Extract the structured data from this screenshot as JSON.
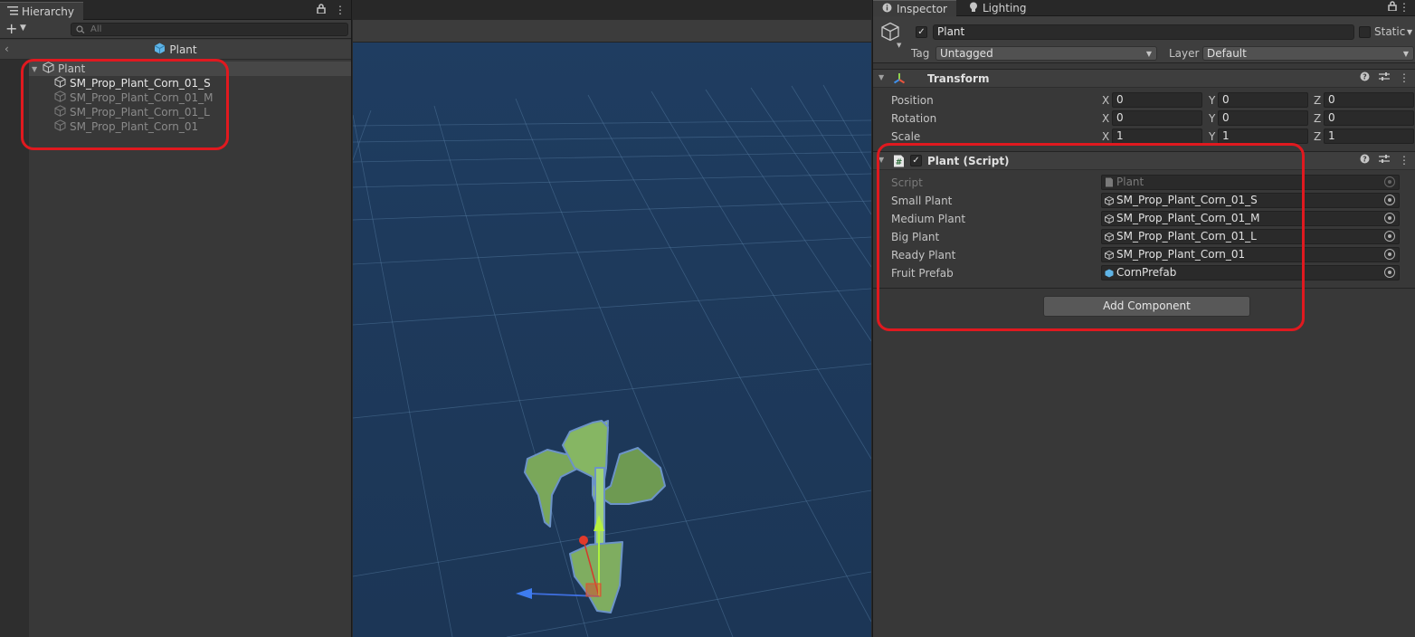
{
  "hierarchy": {
    "tab_label": "Hierarchy",
    "search_placeholder": "All",
    "add_label": "+",
    "scene_title": "Plant",
    "root": "Plant",
    "children": [
      {
        "label": "SM_Prop_Plant_Corn_01_S"
      },
      {
        "label": "SM_Prop_Plant_Corn_01_M"
      },
      {
        "label": "SM_Prop_Plant_Corn_01_L"
      },
      {
        "label": "SM_Prop_Plant_Corn_01"
      }
    ]
  },
  "inspector": {
    "tabs": [
      {
        "label": "Inspector"
      },
      {
        "label": "Lighting"
      }
    ],
    "object_name": "Plant",
    "static_label": "Static",
    "tag_label": "Tag",
    "tag_value": "Untagged",
    "layer_label": "Layer",
    "layer_value": "Default",
    "transform": {
      "title": "Transform",
      "rows": [
        {
          "label": "Position",
          "x": "0",
          "y": "0",
          "z": "0"
        },
        {
          "label": "Rotation",
          "x": "0",
          "y": "0",
          "z": "0"
        },
        {
          "label": "Scale",
          "x": "1",
          "y": "1",
          "z": "1"
        }
      ],
      "axis_x": "X",
      "axis_y": "Y",
      "axis_z": "Z"
    },
    "script_component": {
      "title": "Plant (Script)",
      "fields": [
        {
          "label": "Script",
          "value": "Plant"
        },
        {
          "label": "Small Plant",
          "value": "SM_Prop_Plant_Corn_01_S"
        },
        {
          "label": "Medium Plant",
          "value": "SM_Prop_Plant_Corn_01_M"
        },
        {
          "label": "Big Plant",
          "value": "SM_Prop_Plant_Corn_01_L"
        },
        {
          "label": "Ready Plant",
          "value": "SM_Prop_Plant_Corn_01"
        },
        {
          "label": "Fruit Prefab",
          "value": "CornPrefab"
        }
      ]
    },
    "add_component_label": "Add Component"
  },
  "colors": {
    "annotation": "#e0191f",
    "scene_bg": "#1e3a5c",
    "prefab_blue": "#5fb4e6"
  }
}
